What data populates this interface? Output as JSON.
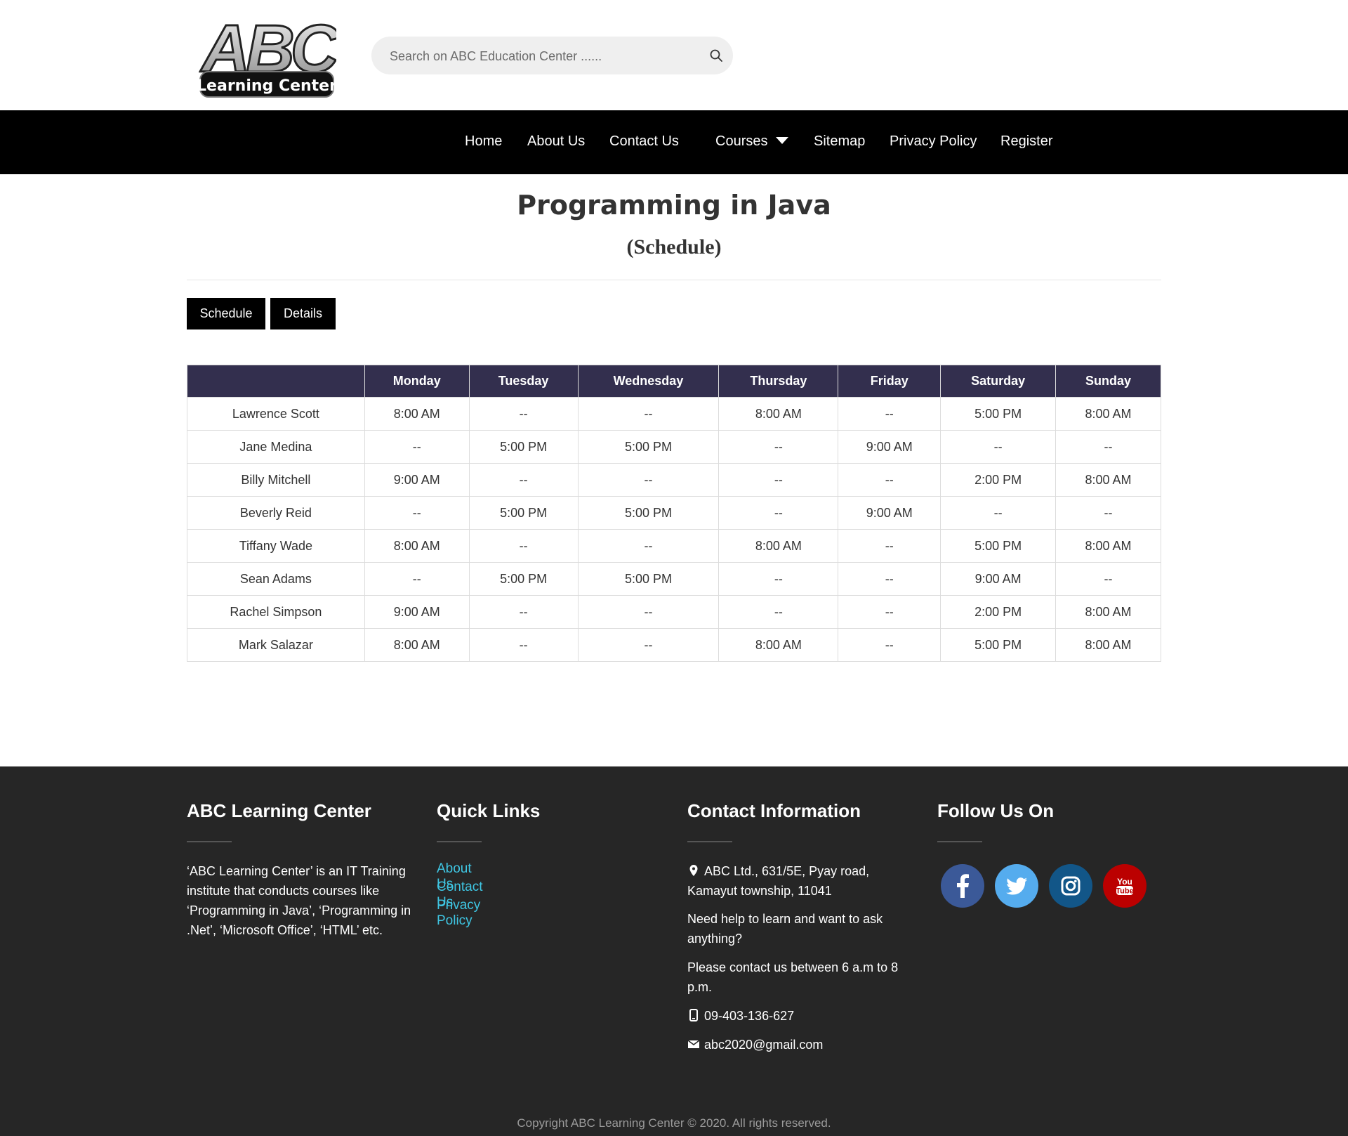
{
  "header": {
    "logo_top": "ABC",
    "logo_bottom": "Learning Center",
    "search_placeholder": "Search on ABC Education Center ......"
  },
  "nav": {
    "items": [
      "Home",
      "About Us",
      "Contact Us",
      "Courses",
      "Sitemap",
      "Privacy Policy",
      "Register"
    ]
  },
  "page": {
    "title": "Programming in Java",
    "subtitle": "(Schedule)"
  },
  "tabs": [
    "Schedule",
    "Details"
  ],
  "schedule": {
    "headers": [
      "",
      "Monday",
      "Tuesday",
      "Wednesday",
      "Thursday",
      "Friday",
      "Saturday",
      "Sunday"
    ],
    "rows": [
      [
        "Lawrence Scott",
        "8:00 AM",
        "--",
        "--",
        "8:00 AM",
        "--",
        "5:00 PM",
        "8:00 AM"
      ],
      [
        "Jane Medina",
        "--",
        "5:00 PM",
        "5:00 PM",
        "--",
        "9:00 AM",
        "--",
        "--"
      ],
      [
        "Billy Mitchell",
        "9:00 AM",
        "--",
        "--",
        "--",
        "--",
        "2:00 PM",
        "8:00 AM"
      ],
      [
        "Beverly Reid",
        "--",
        "5:00 PM",
        "5:00 PM",
        "--",
        "9:00 AM",
        "--",
        "--"
      ],
      [
        "Tiffany Wade",
        "8:00 AM",
        "--",
        "--",
        "8:00 AM",
        "--",
        "5:00 PM",
        "8:00 AM"
      ],
      [
        "Sean Adams",
        "--",
        "5:00 PM",
        "5:00 PM",
        "--",
        "--",
        "9:00 AM",
        "--"
      ],
      [
        "Rachel Simpson",
        "9:00 AM",
        "--",
        "--",
        "--",
        "--",
        "2:00 PM",
        "8:00 AM"
      ],
      [
        "Mark Salazar",
        "8:00 AM",
        "--",
        "--",
        "8:00 AM",
        "--",
        "5:00 PM",
        "8:00 AM"
      ]
    ]
  },
  "footer": {
    "about": {
      "heading": "ABC Learning Center",
      "text": "‘ABC Learning Center’ is an IT Training institute that conducts courses like ‘Programming in Java’, ‘Programming in .Net’, ‘Microsoft Office’, ‘HTML’ etc."
    },
    "quick_links": {
      "heading": "Quick Links",
      "links": [
        "About Us",
        "Contact Us",
        "Privacy Policy"
      ]
    },
    "contact": {
      "heading": "Contact Information",
      "address": "ABC Ltd., 631/5E, Pyay road, Kamayut township, 11041",
      "help": "Need help to learn and want to ask anything?",
      "hours": "Please contact us between 6 a.m to 8 p.m.",
      "phone": "09-403-136-627",
      "email": "abc2020@gmail.com"
    },
    "follow": {
      "heading": "Follow Us On",
      "networks": [
        {
          "icon": "facebook-icon",
          "color": "#3b5998"
        },
        {
          "icon": "twitter-icon",
          "color": "#55acee"
        },
        {
          "icon": "instagram-icon",
          "color": "#125688"
        },
        {
          "icon": "youtube-icon",
          "color": "#bb0000"
        }
      ]
    },
    "copyright": "Copyright  ABC Learning Center © 2020. All rights reserved."
  },
  "colors": {
    "nav_bg": "#000000",
    "table_header_bg": "#332f4e",
    "footer_bg": "#262626",
    "link_color": "#3fc6e3"
  }
}
